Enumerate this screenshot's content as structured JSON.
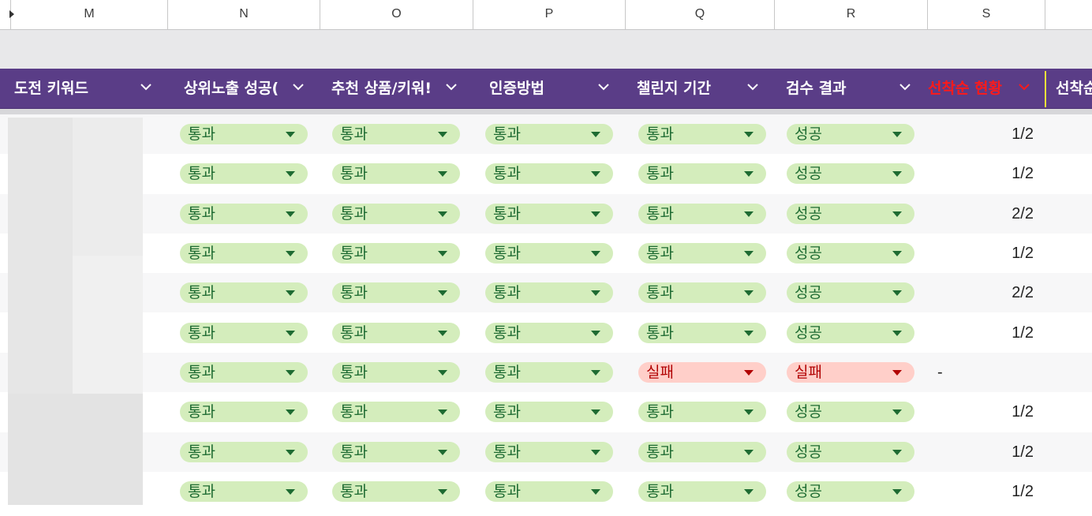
{
  "columns": [
    "M",
    "N",
    "O",
    "P",
    "Q",
    "R",
    "S"
  ],
  "headers": {
    "keyword": "도전 키워드",
    "top_exposure": "상위노출 성공(",
    "recommend": "추천 상품/키워!",
    "auth": "인증방법",
    "period": "챌린지 기간",
    "review": "검수 결과",
    "first_status": "선착순 현황",
    "first_next": "선착순"
  },
  "rows": [
    {
      "n": "통과",
      "o": "통과",
      "p": "통과",
      "q": "통과",
      "r": "성공",
      "s": "1/2"
    },
    {
      "n": "통과",
      "o": "통과",
      "p": "통과",
      "q": "통과",
      "r": "성공",
      "s": "1/2"
    },
    {
      "n": "통과",
      "o": "통과",
      "p": "통과",
      "q": "통과",
      "r": "성공",
      "s": "2/2"
    },
    {
      "n": "통과",
      "o": "통과",
      "p": "통과",
      "q": "통과",
      "r": "성공",
      "s": "1/2"
    },
    {
      "n": "통과",
      "o": "통과",
      "p": "통과",
      "q": "통과",
      "r": "성공",
      "s": "2/2"
    },
    {
      "n": "통과",
      "o": "통과",
      "p": "통과",
      "q": "통과",
      "r": "성공",
      "s": "1/2"
    },
    {
      "n": "통과",
      "o": "통과",
      "p": "통과",
      "q": "실패",
      "r": "실패",
      "s": "-"
    },
    {
      "n": "통과",
      "o": "통과",
      "p": "통과",
      "q": "통과",
      "r": "성공",
      "s": "1/2"
    },
    {
      "n": "통과",
      "o": "통과",
      "p": "통과",
      "q": "통과",
      "r": "성공",
      "s": "1/2"
    },
    {
      "n": "통과",
      "o": "통과",
      "p": "통과",
      "q": "통과",
      "r": "성공",
      "s": "1/2"
    }
  ],
  "colors": {
    "header_bg": "#5a3d87",
    "pass_bg": "#d4edbc",
    "pass_text": "#1e6b32",
    "fail_bg": "#ffcfc9",
    "fail_text": "#b10202",
    "alert_header": "#ff1a1a"
  }
}
